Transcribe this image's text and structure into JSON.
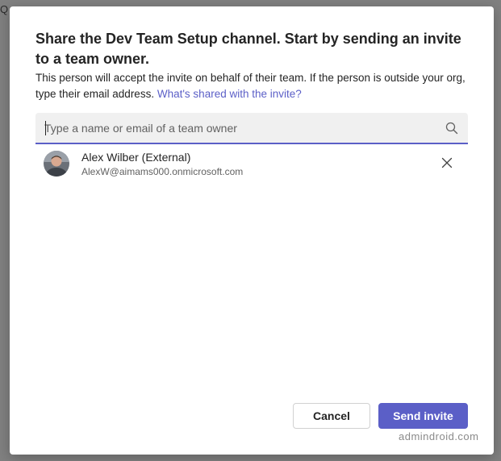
{
  "background": {
    "glyph": "Q"
  },
  "dialog": {
    "title": "Share the Dev Team Setup channel. Start by sending an invite to a team owner.",
    "description": "This person will accept the invite on behalf of their team. If the person is outside your org, type their email address.",
    "description_link": "What's shared with the invite?",
    "search": {
      "placeholder": "Type a name or email of a team owner",
      "value": "",
      "icon": "search-icon"
    },
    "selected_person": {
      "name": "Alex Wilber (External)",
      "email": "AlexW@aimams000.onmicrosoft.com",
      "remove_icon": "close-icon"
    },
    "buttons": {
      "cancel": "Cancel",
      "send": "Send invite"
    }
  },
  "watermark": "admindroid.com",
  "colors": {
    "accent": "#5b5fc7",
    "text": "#242424",
    "secondary_text": "#616161",
    "input_bg": "#f0f0f0",
    "overlay": "#808080"
  }
}
